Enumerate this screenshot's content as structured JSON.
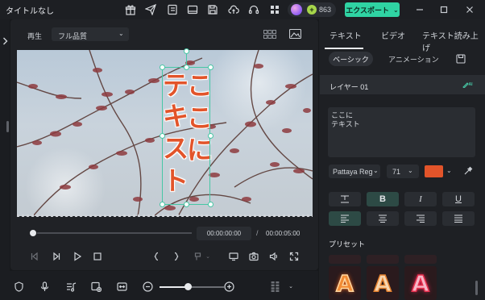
{
  "app": {
    "title": "タイトルなし",
    "credits": "863",
    "export_label": "エクスポート",
    "export_caret": "⌄"
  },
  "player": {
    "play_label": "再生",
    "quality": "フル品質",
    "current_time": "00:00:00:00",
    "separator": "/",
    "total_time": "00:00:05:00",
    "timeline_progress": 0
  },
  "video": {
    "text_column_left": [
      "テ",
      "キ",
      "ス",
      "ト"
    ],
    "text_column_right": [
      "こ",
      "こ",
      "に"
    ]
  },
  "right_panel": {
    "tabs": [
      "テキスト",
      "ビデオ",
      "テキスト読み上げ"
    ],
    "active_tab": "テキスト",
    "subtabs": [
      "ベーシック",
      "アニメーション"
    ],
    "active_subtab": "ベーシック",
    "layer_label": "レイヤー 01",
    "text_lines": [
      "ここに",
      "テキスト"
    ],
    "font": "Pattaya Regular",
    "font_size": "71",
    "text_color": "#e2542a",
    "format_buttons": {
      "bold": "B",
      "italic": "I",
      "underline": "U"
    },
    "active_format": "bold",
    "active_align": "left",
    "preset_label": "プリセット",
    "preset_letter": "A",
    "caret": "⌄",
    "ai_label": "AI"
  },
  "colors": {
    "accent": "#47c7a5",
    "export": "#2fd3a3",
    "background": "#17191c",
    "panel": "#202226"
  }
}
